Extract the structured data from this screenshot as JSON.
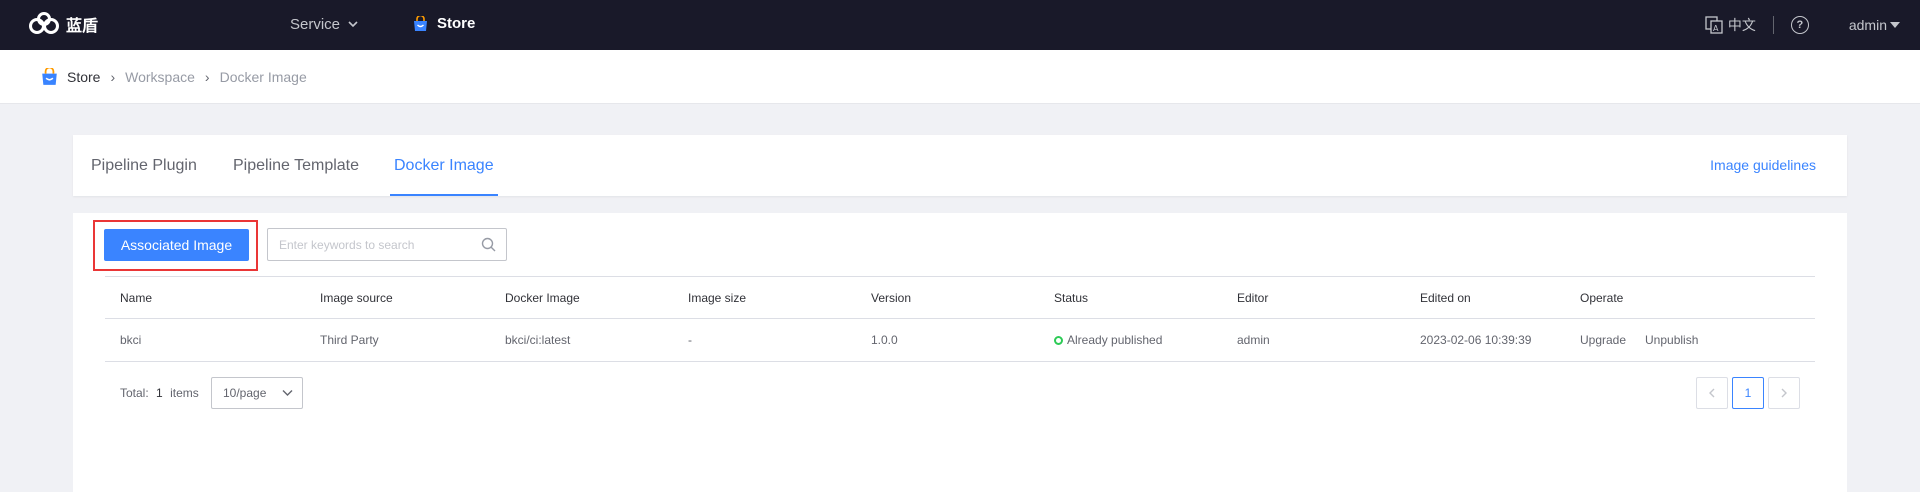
{
  "app": {
    "logo_text": "蓝盾",
    "nav": {
      "service_label": "Service",
      "store_label": "Store"
    },
    "language_label": "中文",
    "help_label": "?",
    "user_label": "admin"
  },
  "breadcrumb": [
    "Store",
    "Workspace",
    "Docker Image"
  ],
  "tabs": [
    {
      "label": "Pipeline Plugin",
      "active": false
    },
    {
      "label": "Pipeline Template",
      "active": false
    },
    {
      "label": "Docker Image",
      "active": true
    }
  ],
  "guide_link": "Image guidelines",
  "toolbar": {
    "associate_button": "Associated Image",
    "search_placeholder": "Enter keywords to search"
  },
  "table": {
    "columns": [
      "Name",
      "Image source",
      "Docker Image",
      "Image size",
      "Version",
      "Status",
      "Editor",
      "Edited on",
      "Operate"
    ],
    "rows": [
      {
        "name": "bkci",
        "source": "Third Party",
        "image": "bkci/ci:latest",
        "size": "-",
        "version": "1.0.0",
        "status": "Already published",
        "editor": "admin",
        "edited_on": "2023-02-06 10:39:39",
        "actions": [
          "Upgrade",
          "Unpublish"
        ]
      }
    ]
  },
  "pagination": {
    "total_prefix": "Total:",
    "total_count": "1",
    "total_suffix": "items",
    "page_size": "10/page",
    "current_page": "1"
  },
  "colors": {
    "accent": "#3a84ff",
    "topbar": "#191929",
    "published": "#2dcb56",
    "highlight": "#ea3636"
  }
}
